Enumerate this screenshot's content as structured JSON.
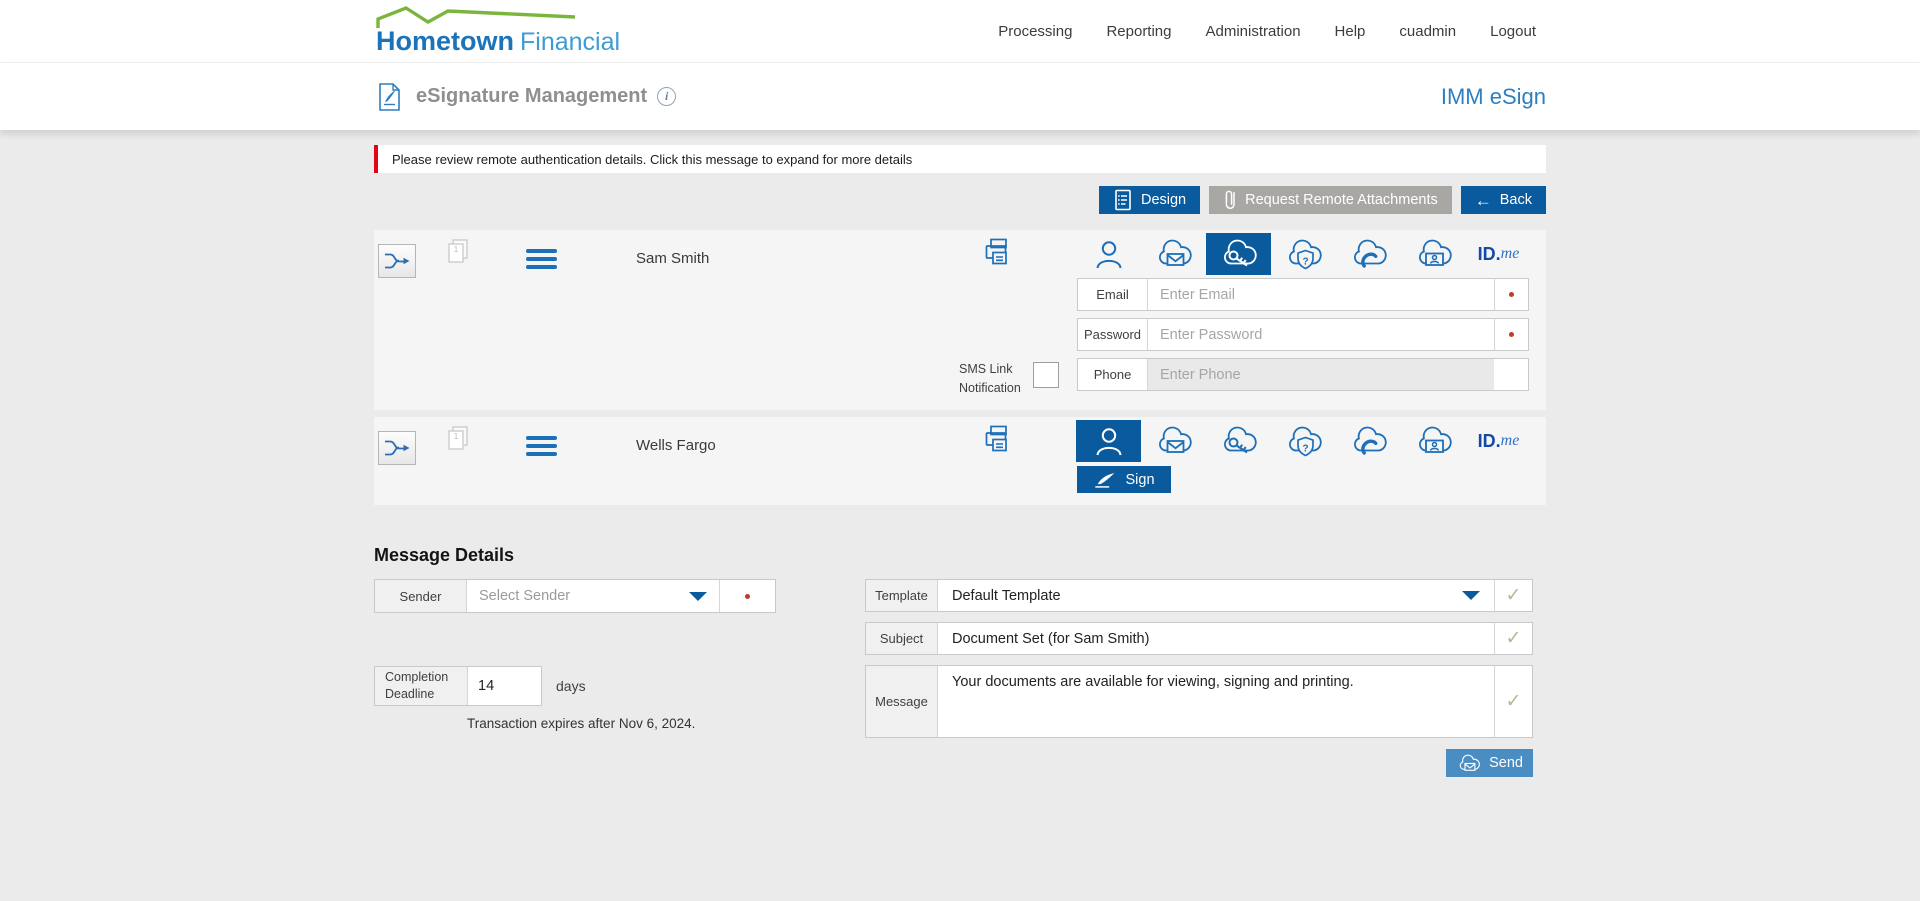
{
  "brand": {
    "name": "Hometown",
    "suffix": "Financial"
  },
  "nav": {
    "items": [
      {
        "label": "Processing"
      },
      {
        "label": "Reporting"
      },
      {
        "label": "Administration"
      },
      {
        "label": "Help"
      },
      {
        "label": "cuadmin"
      },
      {
        "label": "Logout"
      }
    ]
  },
  "titlebar": {
    "title": "eSignature Management",
    "product": "IMM eSign"
  },
  "alert": {
    "message": "Please review remote authentication details. Click this message to expand for more details"
  },
  "actions": {
    "design": "Design",
    "request_attachments": "Request Remote Attachments",
    "back": "Back"
  },
  "recipients": {
    "row1": {
      "name": "Sam Smith",
      "doc_count": "1"
    },
    "row2": {
      "name": "Wells Fargo",
      "doc_count": "1",
      "sign": "Sign"
    }
  },
  "idme": {
    "id": "ID.",
    "me": "me"
  },
  "auth": {
    "email_label": "Email",
    "email_placeholder": "Enter Email",
    "password_label": "Password",
    "password_placeholder": "Enter Password",
    "phone_label": "Phone",
    "phone_placeholder": "Enter Phone",
    "sms_line1": "SMS Link",
    "sms_line2": "Notification"
  },
  "message_details": {
    "heading": "Message Details",
    "sender_label": "Sender",
    "sender_placeholder": "Select Sender",
    "deadline_label1": "Completion",
    "deadline_label2": "Deadline",
    "deadline_value": "14",
    "deadline_units": "days",
    "expiry_note": "Transaction expires after Nov 6, 2024.",
    "template_label": "Template",
    "template_value": "Default Template",
    "subject_label": "Subject",
    "subject_value": "Document Set (for Sam Smith)",
    "message_label": "Message",
    "message_value": "Your documents are available for viewing, signing and printing.",
    "send": "Send"
  },
  "icons": {
    "check": "✓",
    "back_arrow": "←",
    "info_glyph": "i",
    "shield_question": "?"
  },
  "colors": {
    "primary_blue": "#0a5a9e",
    "send_blue": "#4a8dc2",
    "icon_blue": "#1d6fb8",
    "alert_red": "#e20613",
    "check_green": "#a9c08f",
    "logo_green": "#7cb53e"
  }
}
